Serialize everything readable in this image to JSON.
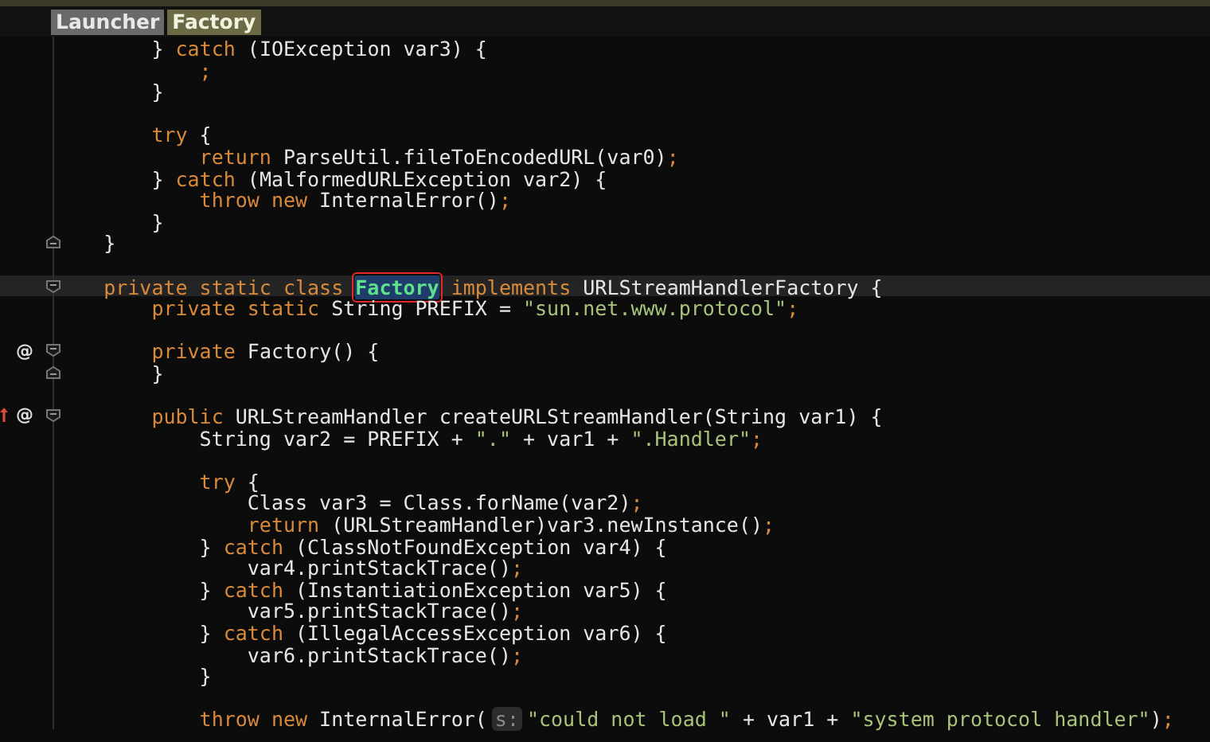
{
  "breadcrumbs": [
    {
      "label": "Launcher",
      "selected": false
    },
    {
      "label": "Factory",
      "selected": true
    }
  ],
  "editor": {
    "lines": [
      {
        "kind": "group",
        "children": [
          {
            "kind": "code",
            "current": false,
            "tokens": [
              {
                "kind": "plain",
                "text": "} "
              },
              {
                "kind": "kw",
                "text": "catch"
              },
              {
                "kind": "plain",
                "text": " (IOException var3) {"
              }
            ],
            "children": [
              {
                "kind": "code",
                "current": false,
                "tokens": [
                  {
                    "kind": "kw",
                    "text": ";"
                  }
                ]
              }
            ]
          },
          {
            "kind": "code",
            "current": false,
            "tokens": [
              {
                "kind": "plain",
                "text": "}"
              }
            ]
          },
          {
            "kind": "blank",
            "current": false
          },
          {
            "kind": "code",
            "current": false,
            "tokens": [
              {
                "kind": "kw",
                "text": "try"
              },
              {
                "kind": "plain",
                "text": " {"
              }
            ],
            "children": [
              {
                "kind": "code",
                "current": false,
                "tokens": [
                  {
                    "kind": "kw",
                    "text": "return"
                  },
                  {
                    "kind": "plain",
                    "text": " ParseUtil.fileToEncodedURL(var0)"
                  },
                  {
                    "kind": "kw",
                    "text": ";"
                  }
                ]
              }
            ]
          },
          {
            "kind": "code",
            "current": false,
            "tokens": [
              {
                "kind": "plain",
                "text": "} "
              },
              {
                "kind": "kw",
                "text": "catch"
              },
              {
                "kind": "plain",
                "text": " (MalformedURLException var2) {"
              }
            ],
            "children": [
              {
                "kind": "code",
                "current": false,
                "tokens": [
                  {
                    "kind": "kw",
                    "text": "throw new"
                  },
                  {
                    "kind": "plain",
                    "text": " InternalError()"
                  },
                  {
                    "kind": "kw",
                    "text": ";"
                  }
                ]
              }
            ]
          },
          {
            "kind": "code",
            "current": false,
            "tokens": [
              {
                "kind": "plain",
                "text": "}"
              }
            ]
          }
        ]
      },
      {
        "kind": "foldclose",
        "current": false,
        "tokens": [
          {
            "kind": "plain",
            "text": "}"
          }
        ]
      },
      {
        "kind": "blank",
        "current": false
      },
      {
        "kind": "foldopen",
        "current": true,
        "tokens": [
          {
            "kind": "kw",
            "text": "private static class "
          },
          {
            "kind": "selected",
            "text": "Factory"
          },
          {
            "kind": "kw",
            "text": " implements"
          },
          {
            "kind": "plain",
            "text": " URLStreamHandlerFactory {"
          }
        ],
        "children": [
          {
            "kind": "code",
            "current": false,
            "tokens": [
              {
                "kind": "kw",
                "text": "private static"
              },
              {
                "kind": "plain",
                "text": " String PREFIX = "
              },
              {
                "kind": "str",
                "text": "\"sun.net.www.protocol\""
              },
              {
                "kind": "kw",
                "text": ";"
              }
            ]
          },
          {
            "kind": "blank",
            "current": false
          },
          {
            "kind": "foldopen",
            "current": false,
            "gutter": [
              {
                "kind": "text",
                "text": "@"
              }
            ],
            "tokens": [
              {
                "kind": "kw",
                "text": "private"
              },
              {
                "kind": "plain",
                "text": " Factory() {"
              }
            ]
          },
          {
            "kind": "foldclose",
            "current": false,
            "tokens": [
              {
                "kind": "plain",
                "text": "}"
              }
            ]
          },
          {
            "kind": "blank",
            "current": false
          },
          {
            "kind": "foldopen",
            "current": false,
            "gutter": [
              {
                "kind": "arrow"
              },
              {
                "kind": "text",
                "text": "@"
              }
            ],
            "tokens": [
              {
                "kind": "kw",
                "text": "public"
              },
              {
                "kind": "plain",
                "text": " URLStreamHandler createURLStreamHandler(String var1) {"
              }
            ],
            "children": [
              {
                "kind": "code",
                "current": false,
                "tokens": [
                  {
                    "kind": "plain",
                    "text": "String var2 = PREFIX + "
                  },
                  {
                    "kind": "str",
                    "text": "\".\""
                  },
                  {
                    "kind": "plain",
                    "text": " + var1 + "
                  },
                  {
                    "kind": "str",
                    "text": "\".Handler\""
                  },
                  {
                    "kind": "kw",
                    "text": ";"
                  }
                ]
              },
              {
                "kind": "blank",
                "current": false
              },
              {
                "kind": "code",
                "current": false,
                "tokens": [
                  {
                    "kind": "kw",
                    "text": "try"
                  },
                  {
                    "kind": "plain",
                    "text": " {"
                  }
                ],
                "children": [
                  {
                    "kind": "code",
                    "current": false,
                    "tokens": [
                      {
                        "kind": "plain",
                        "text": "Class var3 = Class.forName(var2)"
                      },
                      {
                        "kind": "kw",
                        "text": ";"
                      }
                    ]
                  },
                  {
                    "kind": "code",
                    "current": false,
                    "tokens": [
                      {
                        "kind": "kw",
                        "text": "return"
                      },
                      {
                        "kind": "plain",
                        "text": " (URLStreamHandler)var3.newInstance()"
                      },
                      {
                        "kind": "kw",
                        "text": ";"
                      }
                    ]
                  }
                ]
              },
              {
                "kind": "code",
                "current": false,
                "tokens": [
                  {
                    "kind": "plain",
                    "text": "} "
                  },
                  {
                    "kind": "kw",
                    "text": "catch"
                  },
                  {
                    "kind": "plain",
                    "text": " (ClassNotFoundException var4) {"
                  }
                ],
                "children": [
                  {
                    "kind": "code",
                    "current": false,
                    "tokens": [
                      {
                        "kind": "plain",
                        "text": "var4.printStackTrace()"
                      },
                      {
                        "kind": "kw",
                        "text": ";"
                      }
                    ]
                  }
                ]
              },
              {
                "kind": "code",
                "current": false,
                "tokens": [
                  {
                    "kind": "plain",
                    "text": "} "
                  },
                  {
                    "kind": "kw",
                    "text": "catch"
                  },
                  {
                    "kind": "plain",
                    "text": " (InstantiationException var5) {"
                  }
                ],
                "children": [
                  {
                    "kind": "code",
                    "current": false,
                    "tokens": [
                      {
                        "kind": "plain",
                        "text": "var5.printStackTrace()"
                      },
                      {
                        "kind": "kw",
                        "text": ";"
                      }
                    ]
                  }
                ]
              },
              {
                "kind": "code",
                "current": false,
                "tokens": [
                  {
                    "kind": "plain",
                    "text": "} "
                  },
                  {
                    "kind": "kw",
                    "text": "catch"
                  },
                  {
                    "kind": "plain",
                    "text": " (IllegalAccessException var6) {"
                  }
                ],
                "children": [
                  {
                    "kind": "code",
                    "current": false,
                    "tokens": [
                      {
                        "kind": "plain",
                        "text": "var6.printStackTrace()"
                      },
                      {
                        "kind": "kw",
                        "text": ";"
                      }
                    ]
                  }
                ]
              },
              {
                "kind": "code",
                "current": false,
                "tokens": [
                  {
                    "kind": "plain",
                    "text": "}"
                  }
                ]
              },
              {
                "kind": "blank",
                "current": false
              },
              {
                "kind": "code",
                "current": false,
                "tokens": [
                  {
                    "kind": "kw",
                    "text": "throw new"
                  },
                  {
                    "kind": "plain",
                    "text": " InternalError("
                  },
                  {
                    "kind": "hint",
                    "text": "s:"
                  },
                  {
                    "kind": "str",
                    "text": "\"could not load \""
                  },
                  {
                    "kind": "plain",
                    "text": " + var1 + "
                  },
                  {
                    "kind": "str",
                    "text": "\"system protocol handler\""
                  },
                  {
                    "kind": "plain",
                    "text": ")"
                  },
                  {
                    "kind": "kw",
                    "text": ";"
                  }
                ]
              }
            ]
          }
        ]
      }
    ]
  }
}
